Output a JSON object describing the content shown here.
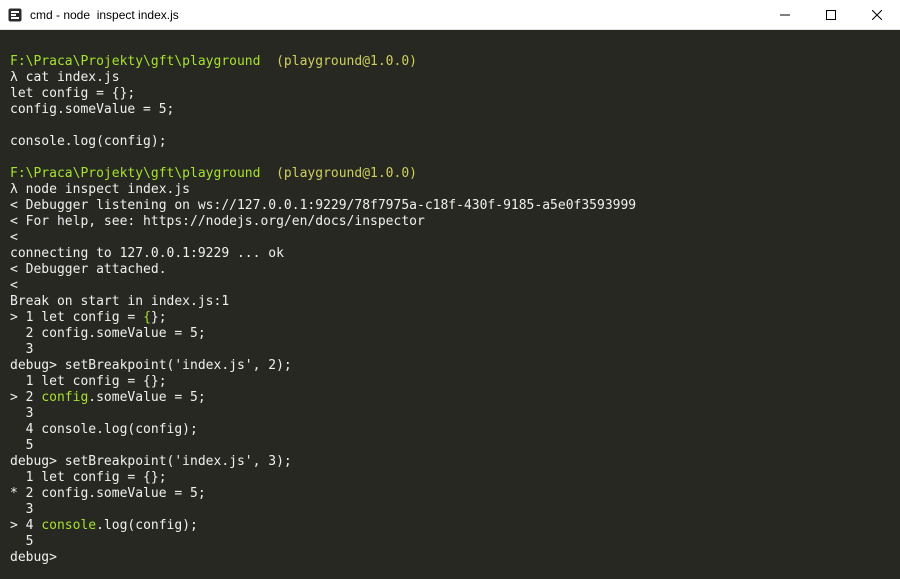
{
  "window": {
    "title": "cmd - node  inspect index.js",
    "icons": {
      "app": "cmder-icon",
      "minimize": "minimize-icon",
      "maximize": "maximize-icon",
      "close": "close-icon"
    }
  },
  "colors": {
    "background": "#272822",
    "text": "#f0f0f0",
    "green": "#a6e22e",
    "yellow": "#cfcf5b"
  },
  "terminal": {
    "lines": [
      [
        {
          "text": "F:\\Praca\\Projekty\\gft\\playground",
          "color": "g"
        },
        {
          "text": "  ",
          "color": ""
        },
        {
          "text": "(playground@1.0.0)",
          "color": "y"
        }
      ],
      [
        {
          "text": "λ cat index.js",
          "color": ""
        }
      ],
      [
        {
          "text": "let config = {};",
          "color": ""
        }
      ],
      [
        {
          "text": "config.someValue = 5;",
          "color": ""
        }
      ],
      [
        {
          "text": "",
          "color": ""
        }
      ],
      [
        {
          "text": "console.log(config);",
          "color": ""
        }
      ],
      [
        {
          "text": "",
          "color": ""
        }
      ],
      [
        {
          "text": "F:\\Praca\\Projekty\\gft\\playground",
          "color": "g"
        },
        {
          "text": "  ",
          "color": ""
        },
        {
          "text": "(playground@1.0.0)",
          "color": "y"
        }
      ],
      [
        {
          "text": "λ node inspect index.js",
          "color": ""
        }
      ],
      [
        {
          "text": "< Debugger listening on ws://127.0.0.1:9229/78f7975a-c18f-430f-9185-a5e0f3593999",
          "color": ""
        }
      ],
      [
        {
          "text": "< For help, see: https://nodejs.org/en/docs/inspector",
          "color": ""
        }
      ],
      [
        {
          "text": "<",
          "color": ""
        }
      ],
      [
        {
          "text": "connecting to 127.0.0.1:9229 ... ok",
          "color": ""
        }
      ],
      [
        {
          "text": "< Debugger attached.",
          "color": ""
        }
      ],
      [
        {
          "text": "<",
          "color": ""
        }
      ],
      [
        {
          "text": "Break on start in index.js:1",
          "color": ""
        }
      ],
      [
        {
          "text": "> 1 let config = ",
          "color": ""
        },
        {
          "text": "{",
          "color": "g"
        },
        {
          "text": "};",
          "color": ""
        }
      ],
      [
        {
          "text": "  2 config.someValue = 5;",
          "color": ""
        }
      ],
      [
        {
          "text": "  3",
          "color": ""
        }
      ],
      [
        {
          "text": "debug> setBreakpoint('index.js', 2);",
          "color": ""
        }
      ],
      [
        {
          "text": "  1 let config = {};",
          "color": ""
        }
      ],
      [
        {
          "text": "> 2 ",
          "color": ""
        },
        {
          "text": "config",
          "color": "g"
        },
        {
          "text": ".someValue = 5;",
          "color": ""
        }
      ],
      [
        {
          "text": "  3",
          "color": ""
        }
      ],
      [
        {
          "text": "  4 console.log(config);",
          "color": ""
        }
      ],
      [
        {
          "text": "  5",
          "color": ""
        }
      ],
      [
        {
          "text": "debug> setBreakpoint('index.js', 3);",
          "color": ""
        }
      ],
      [
        {
          "text": "  1 let config = {};",
          "color": ""
        }
      ],
      [
        {
          "text": "* 2 config.someValue = 5;",
          "color": ""
        }
      ],
      [
        {
          "text": "  3",
          "color": ""
        }
      ],
      [
        {
          "text": "> 4 ",
          "color": ""
        },
        {
          "text": "console",
          "color": "g"
        },
        {
          "text": ".log(config);",
          "color": ""
        }
      ],
      [
        {
          "text": "  5",
          "color": ""
        }
      ],
      [
        {
          "text": "debug>",
          "color": ""
        }
      ]
    ]
  }
}
